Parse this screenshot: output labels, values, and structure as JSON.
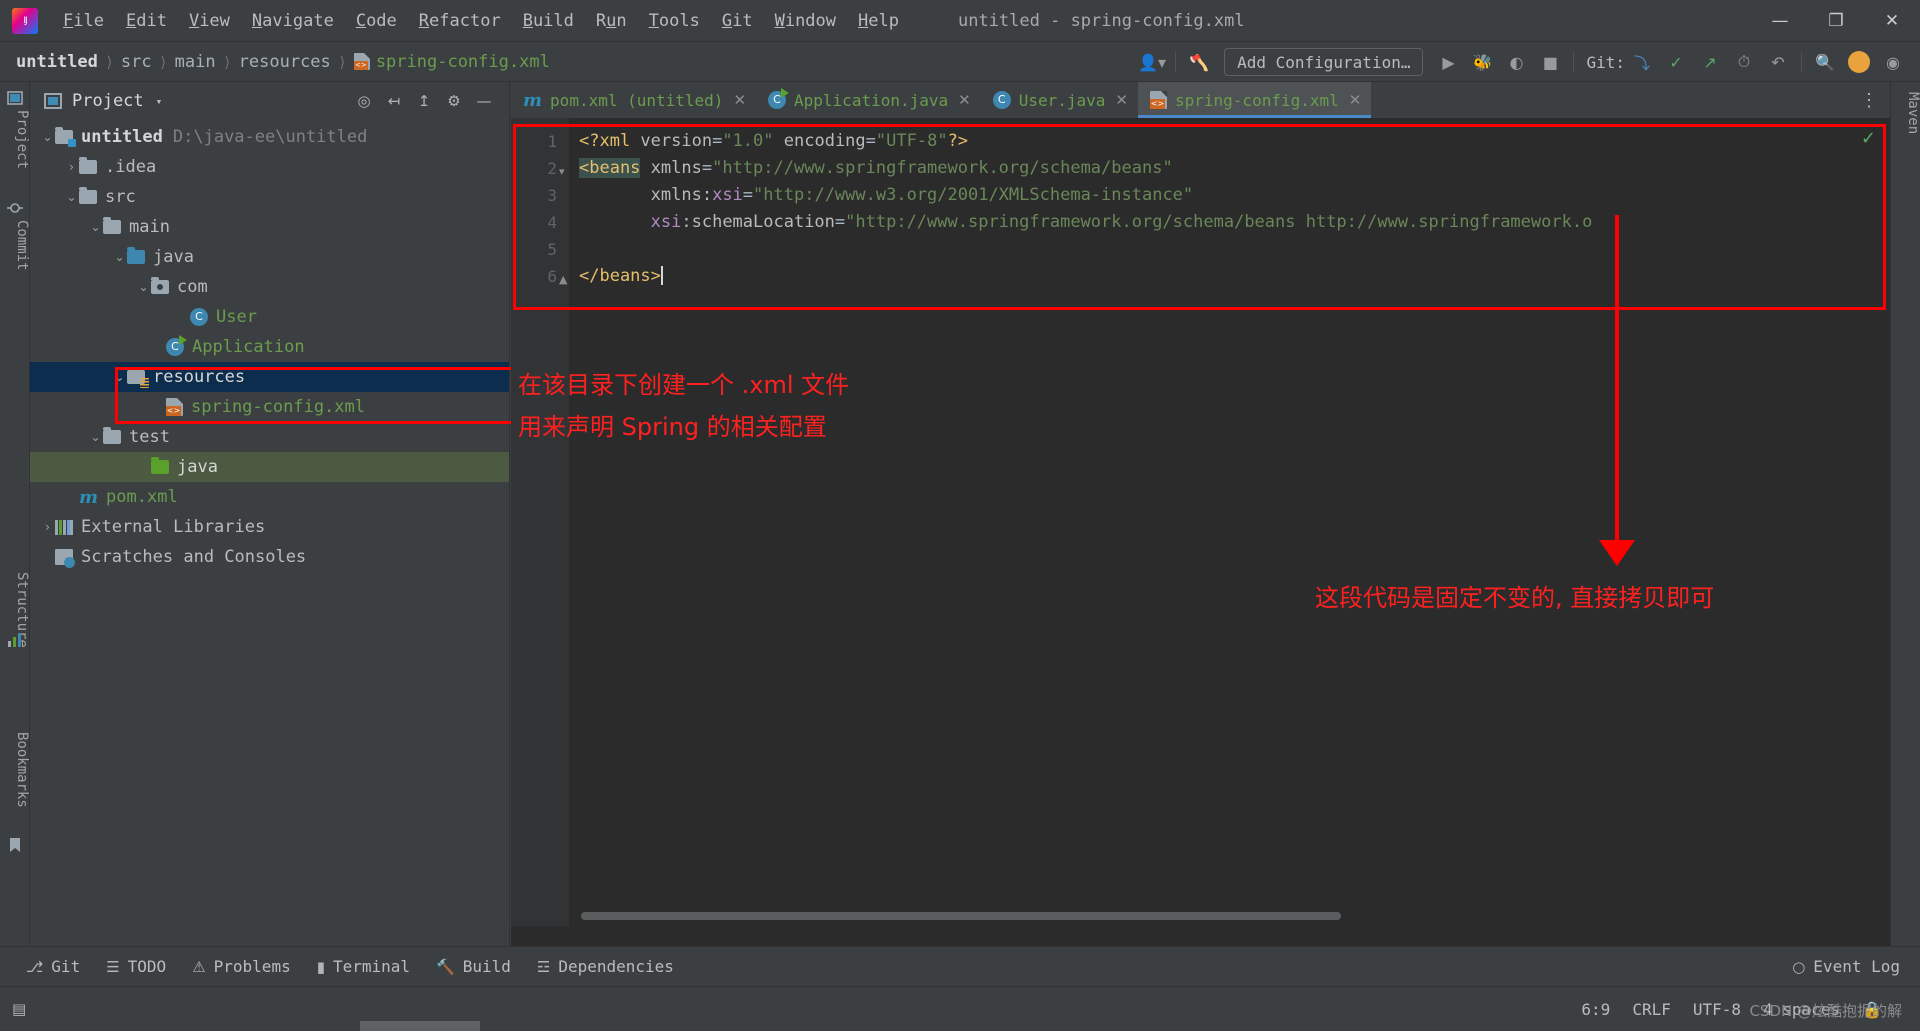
{
  "window": {
    "title": "untitled - spring-config.xml",
    "logo_icon": "intellij-idea-logo",
    "controls": {
      "minimize": "—",
      "maximize": "❐",
      "close": "✕"
    }
  },
  "menubar": {
    "items": [
      {
        "label": "File",
        "mnemonic": "F"
      },
      {
        "label": "Edit",
        "mnemonic": "E"
      },
      {
        "label": "View",
        "mnemonic": "V"
      },
      {
        "label": "Navigate",
        "mnemonic": "N"
      },
      {
        "label": "Code",
        "mnemonic": "C"
      },
      {
        "label": "Refactor",
        "mnemonic": "R"
      },
      {
        "label": "Build",
        "mnemonic": "B"
      },
      {
        "label": "Run",
        "mnemonic": "u"
      },
      {
        "label": "Tools",
        "mnemonic": "T"
      },
      {
        "label": "Git",
        "mnemonic": "G"
      },
      {
        "label": "Window",
        "mnemonic": "W"
      },
      {
        "label": "Help",
        "mnemonic": "H"
      }
    ]
  },
  "navbar": {
    "breadcrumbs": [
      {
        "label": "untitled",
        "style": "bold"
      },
      {
        "label": "src",
        "style": "normal"
      },
      {
        "label": "main",
        "style": "normal"
      },
      {
        "label": "resources",
        "style": "normal"
      },
      {
        "label": "spring-config.xml",
        "style": "green",
        "icon": "xml-file-icon"
      }
    ],
    "separator": "⟩",
    "add_configuration": "Add Configuration…",
    "git_label": "Git:",
    "icons": [
      "user-avatar-icon",
      "build-hammer-icon",
      "run-icon",
      "debug-icon",
      "run-coverage-icon",
      "stop-icon",
      "git-update-icon",
      "git-commit-icon",
      "git-push-icon",
      "git-history-icon",
      "undo-icon",
      "search-icon",
      "account-icon",
      "plugin-icon"
    ]
  },
  "left_toolstrip": {
    "tabs": [
      "Project",
      "Commit",
      "Structure",
      "Bookmarks"
    ]
  },
  "right_toolstrip": {
    "tabs": [
      "Maven"
    ]
  },
  "project_panel": {
    "title": "Project",
    "view_caret": "▾",
    "header_icons": [
      "locate-target-icon",
      "expand-all-icon",
      "collapse-all-icon",
      "settings-gear-icon",
      "hide-panel-icon"
    ],
    "tree": [
      {
        "label": "untitled",
        "suffix": "D:\\java-ee\\untitled",
        "depth": 0,
        "arrow": "⌄",
        "icon": "project-folder-icon",
        "style": "bold",
        "selected": "none"
      },
      {
        "label": ".idea",
        "depth": 1,
        "arrow": "›",
        "icon": "folder-gray-icon",
        "style": "plain",
        "selected": "none"
      },
      {
        "label": "src",
        "depth": 1,
        "arrow": "⌄",
        "icon": "folder-gray-icon",
        "style": "plain",
        "selected": "none"
      },
      {
        "label": "main",
        "depth": 2,
        "arrow": "⌄",
        "icon": "folder-gray-icon",
        "style": "plain",
        "selected": "none"
      },
      {
        "label": "java",
        "depth": 3,
        "arrow": "⌄",
        "icon": "folder-source-blue-icon",
        "style": "plain",
        "selected": "none"
      },
      {
        "label": "com",
        "depth": 4,
        "arrow": "⌄",
        "icon": "package-icon",
        "style": "plain",
        "selected": "none"
      },
      {
        "label": "User",
        "depth": 5,
        "arrow": "",
        "icon": "java-class-icon",
        "style": "green",
        "selected": "none"
      },
      {
        "label": "Application",
        "depth": 4,
        "arrow": "",
        "icon": "java-runnable-class-icon",
        "style": "green",
        "selected": "none"
      },
      {
        "label": "resources",
        "depth": 3,
        "arrow": "⌄",
        "icon": "folder-resources-icon",
        "style": "plain",
        "selected": "blue"
      },
      {
        "label": "spring-config.xml",
        "depth": 4,
        "arrow": "",
        "icon": "xml-file-icon",
        "style": "green",
        "selected": "none"
      },
      {
        "label": "test",
        "depth": 2,
        "arrow": "⌄",
        "icon": "folder-gray-icon",
        "style": "plain",
        "selected": "none"
      },
      {
        "label": "java",
        "depth": 3,
        "arrow": "",
        "icon": "folder-test-green-icon",
        "style": "plain",
        "selected": "green"
      },
      {
        "label": "pom.xml",
        "depth": 1,
        "arrow": "",
        "icon": "maven-pom-icon",
        "style": "green",
        "selected": "none"
      },
      {
        "label": "External Libraries",
        "depth": 0,
        "arrow": "›",
        "icon": "libraries-icon",
        "style": "plain",
        "selected": "none"
      },
      {
        "label": "Scratches and Consoles",
        "depth": 0,
        "arrow": "",
        "icon": "scratches-icon",
        "style": "plain",
        "selected": "none"
      }
    ]
  },
  "editor": {
    "tabs": [
      {
        "label": "pom.xml (untitled)",
        "icon": "maven-pom-icon",
        "active": false,
        "close": "✕"
      },
      {
        "label": "Application.java",
        "icon": "java-runnable-class-icon",
        "active": false,
        "close": "✕"
      },
      {
        "label": "User.java",
        "icon": "java-class-icon",
        "active": false,
        "close": "✕"
      },
      {
        "label": "spring-config.xml",
        "icon": "xml-file-icon",
        "active": true,
        "close": "✕"
      }
    ],
    "tab_options_icon": "more-vertical-icon",
    "inspection_status": "✓",
    "line_numbers": [
      "1",
      "2",
      "3",
      "4",
      "5",
      "6"
    ],
    "code": [
      {
        "n": 1,
        "segments": [
          {
            "t": "<?xml ",
            "c": "decl"
          },
          {
            "t": "version",
            "c": "attr"
          },
          {
            "t": "=",
            "c": "plain"
          },
          {
            "t": "\"1.0\"",
            "c": "val"
          },
          {
            "t": " ",
            "c": "plain"
          },
          {
            "t": "encoding",
            "c": "attr"
          },
          {
            "t": "=",
            "c": "plain"
          },
          {
            "t": "\"UTF-8\"",
            "c": "val"
          },
          {
            "t": "?>",
            "c": "decl"
          }
        ]
      },
      {
        "n": 2,
        "segments": [
          {
            "t": "<beans",
            "c": "hl"
          },
          {
            "t": " ",
            "c": "plain"
          },
          {
            "t": "xmlns",
            "c": "attr"
          },
          {
            "t": "=",
            "c": "plain"
          },
          {
            "t": "\"http://www.springframework.org/schema/beans\"",
            "c": "val"
          }
        ]
      },
      {
        "n": 3,
        "segments": [
          {
            "t": "       ",
            "c": "plain"
          },
          {
            "t": "xmlns:",
            "c": "attr"
          },
          {
            "t": "xsi",
            "c": "ns"
          },
          {
            "t": "=",
            "c": "plain"
          },
          {
            "t": "\"http://www.w3.org/2001/XMLSchema-instance\"",
            "c": "val"
          }
        ]
      },
      {
        "n": 4,
        "segments": [
          {
            "t": "       ",
            "c": "plain"
          },
          {
            "t": "xsi",
            "c": "ns"
          },
          {
            "t": ":schemaLocation",
            "c": "attr"
          },
          {
            "t": "=",
            "c": "plain"
          },
          {
            "t": "\"http://www.springframework.org/schema/beans http://www.springframework.o",
            "c": "val"
          }
        ]
      },
      {
        "n": 5,
        "segments": [
          {
            "t": "",
            "c": "plain"
          }
        ]
      },
      {
        "n": 6,
        "segments": [
          {
            "t": "</beans>",
            "c": "tag"
          }
        ]
      }
    ]
  },
  "annotations": [
    {
      "id": "anno-line-1",
      "text": "在该目录下创建一个 .xml 文件"
    },
    {
      "id": "anno-line-2",
      "text": "用来声明 Spring 的相关配置"
    },
    {
      "id": "anno-line-3",
      "text": "这段代码是固定不变的, 直接拷贝即可"
    }
  ],
  "annotation_color": "#ff0000",
  "bottom_bar": {
    "items": [
      {
        "label": "Git",
        "icon": "git-branch-icon"
      },
      {
        "label": "TODO",
        "icon": "todo-list-icon"
      },
      {
        "label": "Problems",
        "icon": "problems-warning-icon"
      },
      {
        "label": "Terminal",
        "icon": "terminal-icon"
      },
      {
        "label": "Build",
        "icon": "build-hammer-icon"
      },
      {
        "label": "Dependencies",
        "icon": "dependencies-icon"
      }
    ],
    "event_log": {
      "label": "Event Log",
      "icon": "event-log-icon"
    }
  },
  "status_bar": {
    "caret_position": "6:9",
    "line_separator": "CRLF",
    "encoding": "UTF-8",
    "indent": "4 spaces",
    "lock_icon": "lock-icon",
    "watermark": "CSDN @炫酷抱抳的解"
  },
  "colors": {
    "chrome_bg": "#3c3f41",
    "editor_bg": "#2b2b2b",
    "gutter_bg": "#313335",
    "selection_blue": "#0d2d4e",
    "selection_green": "#4b5a41",
    "accent_blue": "#4a88c7",
    "string_green": "#6a8759",
    "tag_yellow": "#e8bf6a",
    "ns_purple": "#b389c5",
    "annotation_red": "#ff0000"
  }
}
